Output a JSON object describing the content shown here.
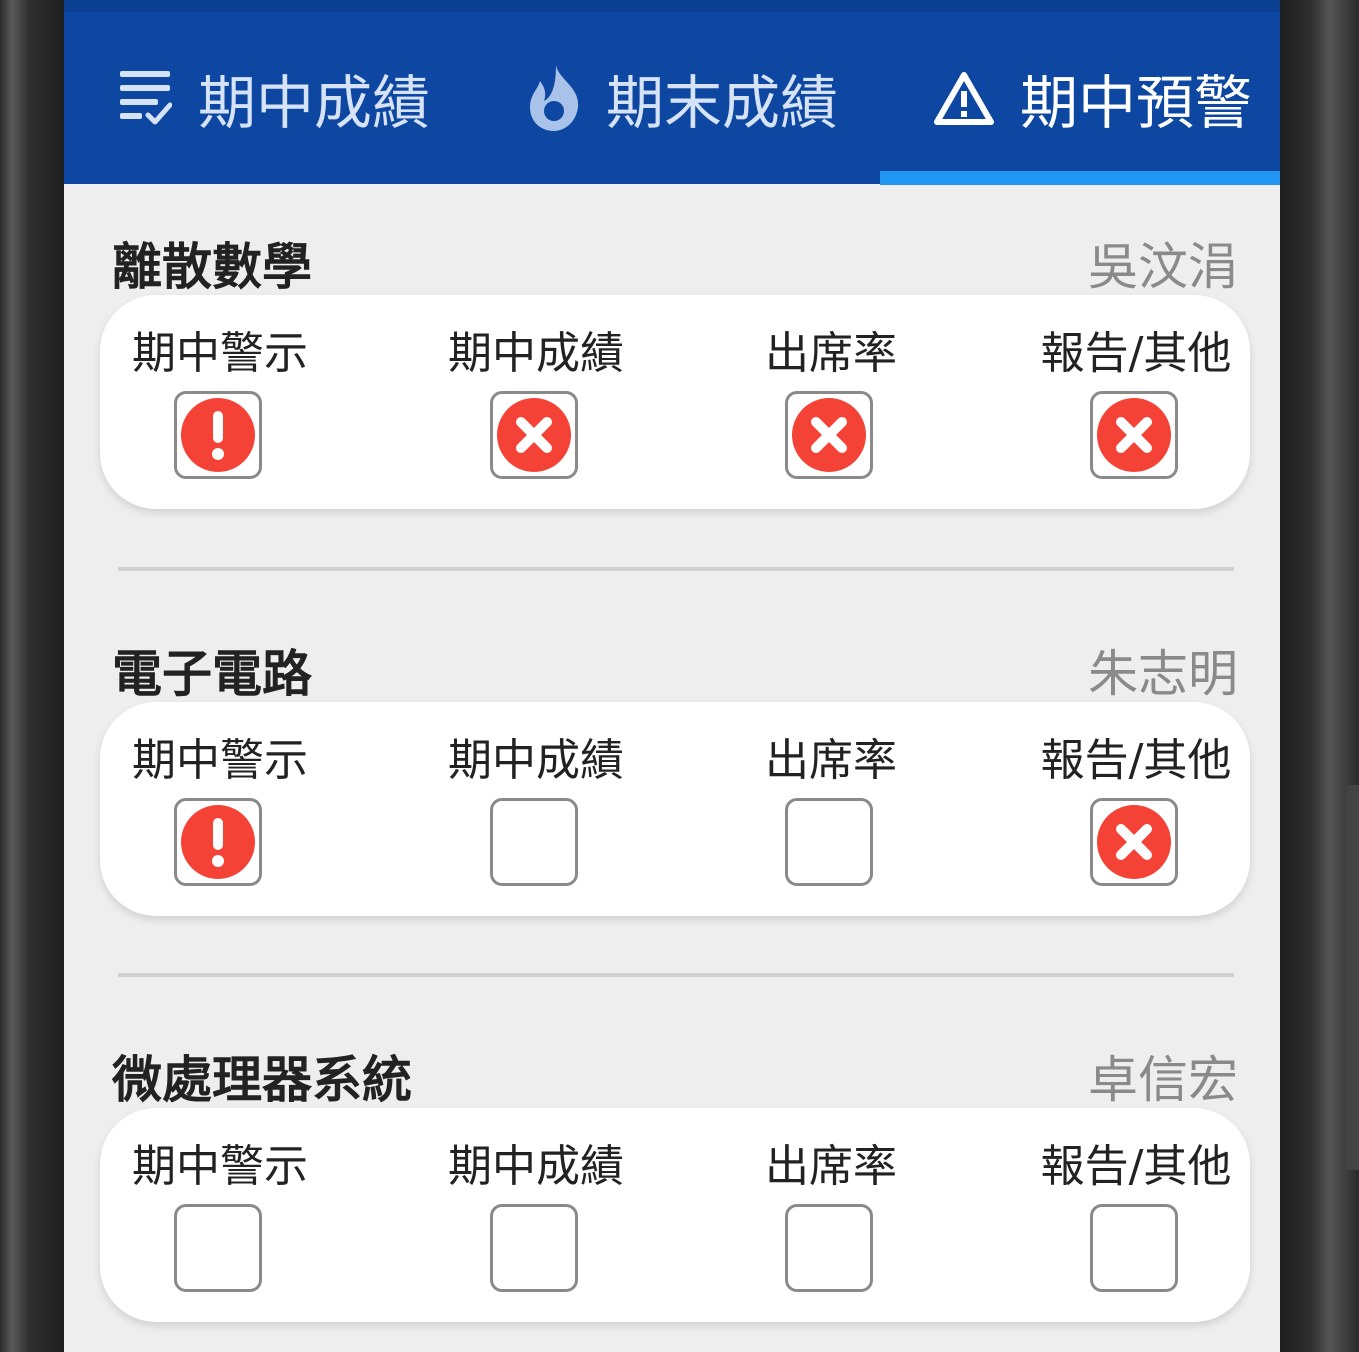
{
  "tabs": [
    {
      "label": "期中成績",
      "icon": "list-check-icon"
    },
    {
      "label": "期末成績",
      "icon": "flame-icon"
    },
    {
      "label": "期中預警",
      "icon": "warning-icon",
      "active": true
    }
  ],
  "colors": {
    "tab_bar": "#0d47a1",
    "indicator": "#2196f3",
    "alert_red": "#f44336"
  },
  "courses": [
    {
      "name": "離散數學",
      "teacher": "吳汶涓",
      "items": [
        {
          "label": "期中警示",
          "status": "exclamation"
        },
        {
          "label": "期中成績",
          "status": "x"
        },
        {
          "label": "出席率",
          "status": "x"
        },
        {
          "label": "報告/其他",
          "status": "x"
        }
      ]
    },
    {
      "name": "電子電路",
      "teacher": "朱志明",
      "items": [
        {
          "label": "期中警示",
          "status": "exclamation"
        },
        {
          "label": "期中成績",
          "status": "empty"
        },
        {
          "label": "出席率",
          "status": "empty"
        },
        {
          "label": "報告/其他",
          "status": "x"
        }
      ]
    },
    {
      "name": "微處理器系統",
      "teacher": "卓信宏",
      "items": [
        {
          "label": "期中警示",
          "status": "empty"
        },
        {
          "label": "期中成績",
          "status": "empty"
        },
        {
          "label": "出席率",
          "status": "empty"
        },
        {
          "label": "報告/其他",
          "status": "empty"
        }
      ]
    }
  ]
}
